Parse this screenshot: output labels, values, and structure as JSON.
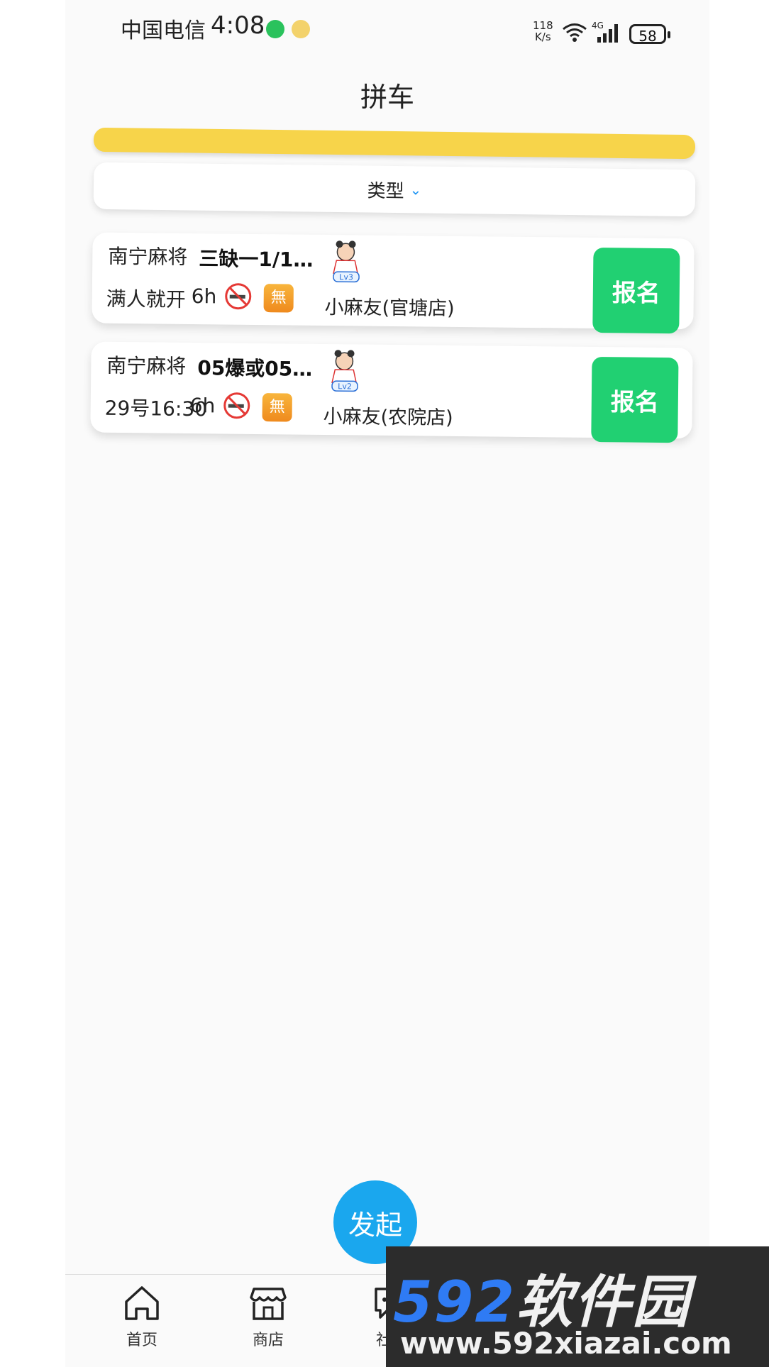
{
  "status_bar": {
    "carrier": "中国电信",
    "time": "4:08",
    "net_speed_value": "118",
    "net_speed_unit": "K/s",
    "network": "4G",
    "battery": "58"
  },
  "header": {
    "title": "拼车"
  },
  "filter": {
    "type_label": "类型"
  },
  "listings": [
    {
      "game": "南宁麻将",
      "description": "三缺一1/1…",
      "start_time": "满人就开",
      "duration": "6h",
      "level": "Lv3",
      "store": "小麻友(官塘店)",
      "action": "报名"
    },
    {
      "game": "南宁麻将",
      "description": "05爆或05…",
      "start_time": "29号16:30",
      "duration": "6h",
      "level": "Lv2",
      "store": "小麻友(农院店)",
      "action": "报名"
    }
  ],
  "fab": {
    "label": "发起"
  },
  "nav": {
    "home": "首页",
    "shop": "商店",
    "group": "社群"
  },
  "watermark": {
    "brand_num": "592",
    "brand_cn": "软件园",
    "url": "www.592xiazai.com"
  },
  "icons": {
    "mark_char": "無"
  },
  "colors": {
    "accent_yellow": "#f7d44a",
    "signup_green": "#21d072",
    "fab_blue": "#1aa7ee"
  }
}
